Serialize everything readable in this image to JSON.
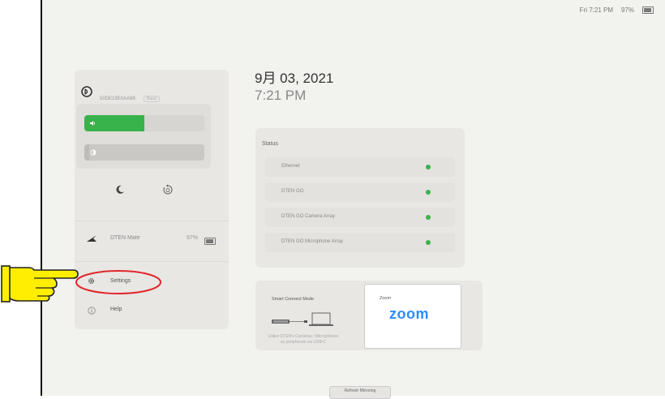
{
  "statusbar": {
    "clock": "Fri 7:21 PM",
    "battery": "97%"
  },
  "device": {
    "name": "50DE19E0AA88",
    "badge": "Basic"
  },
  "volume": {
    "level": 0.5
  },
  "brightness": {
    "level": 0.04
  },
  "dten_mate": {
    "label": "DTEN Mate",
    "battery": "97%"
  },
  "menu": {
    "settings": "Settings",
    "help": "Help"
  },
  "header": {
    "date": "9月 03, 2021",
    "time": "7:21 PM"
  },
  "status": {
    "title": "Status",
    "items": [
      {
        "label": "Ethernet",
        "state": "green"
      },
      {
        "label": "DTEN GO",
        "state": "green"
      },
      {
        "label": "DTEN GO Camera Array",
        "state": "green"
      },
      {
        "label": "DTEN GO Microphone Array",
        "state": "green"
      }
    ]
  },
  "smart_connect": {
    "title": "Smart Connect Mode",
    "desc_line1": "Utilize DTEN's Cameras / Microphones",
    "desc_line2": "as peripherals via USB-C"
  },
  "zoom": {
    "title": "Zoom",
    "logo": "zoom"
  },
  "refresh_button": "Refresh Mirroring",
  "colors": {
    "accent_green": "#38b24a",
    "zoom_blue": "#2d8cff",
    "annotation_red": "#e2262a",
    "pointer_yellow": "#ffee00"
  }
}
